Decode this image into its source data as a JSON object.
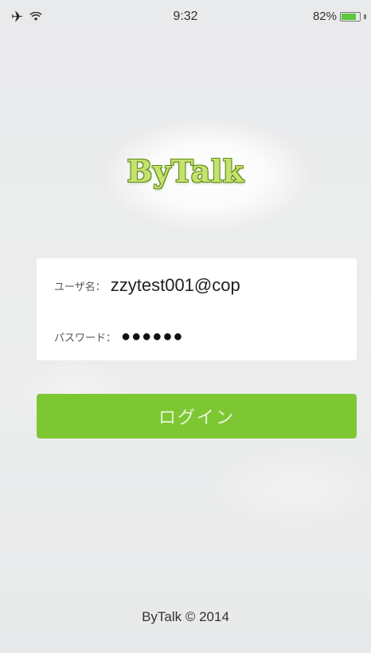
{
  "status_bar": {
    "time": "9:32",
    "battery_text": "82%",
    "battery_level": 0.82,
    "left_icons": [
      "airplane-icon",
      "wifi-icon"
    ],
    "battery_color": "#5ec63a"
  },
  "logo": {
    "text": "ByTalk",
    "color": "#c6e26e",
    "outline_color": "#5e8a16"
  },
  "form": {
    "username_label": "ユーザ名：",
    "username_value": "zzytest001@cop",
    "password_label": "パスワード：",
    "password_value": "●●●●●●"
  },
  "login_button": {
    "label": "ログイン",
    "color": "#7dc733"
  },
  "footer": {
    "text": "ByTalk © 2014"
  }
}
